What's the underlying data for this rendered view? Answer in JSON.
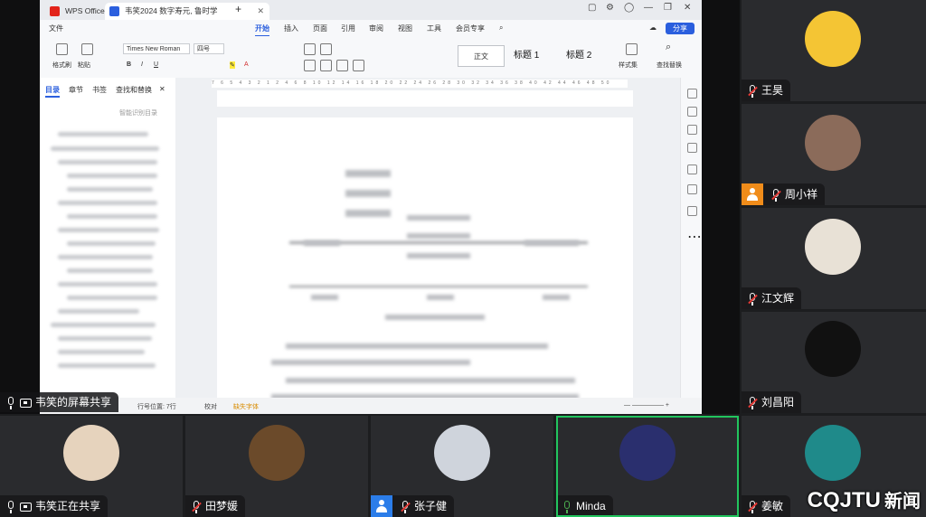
{
  "screen_share": {
    "tabs": [
      {
        "label": "WPS Office"
      },
      {
        "label": "韦笑2024 数字寿元, 鲁时学"
      }
    ],
    "menu": {
      "file": "文件",
      "tabs": [
        "开始",
        "插入",
        "页面",
        "引用",
        "审阅",
        "视图",
        "工具",
        "会员专享"
      ],
      "share": "分享"
    },
    "ribbon": {
      "format_painter": "格式刷",
      "paste": "粘贴",
      "font": "Times New Roman",
      "size": "四号",
      "style_normal": "正文",
      "heading1": "标题 1",
      "heading2": "标题 2",
      "styles_set": "样式集",
      "find_replace": "查找替换"
    },
    "left_panel": {
      "tabs": [
        "目录",
        "章节",
        "书签",
        "查找和替换"
      ],
      "toc_button": "智能识别目录"
    },
    "status_bar": {
      "position": "行号位置: 7行",
      "proofread": "校对",
      "missing_font": "缺失字体"
    },
    "sharer_caption": "韦笑的屏幕共享"
  },
  "participants_right": [
    {
      "name": "王昊",
      "avatar_color": "#f4c534"
    },
    {
      "name": "周小祥",
      "avatar_color": "#8b6b5a"
    },
    {
      "name": "江文辉",
      "avatar_color": "#e8e1d6"
    },
    {
      "name": "刘昌阳",
      "avatar_color": "#111111"
    }
  ],
  "participants_bottom": [
    {
      "name": "韦笑正在共享",
      "avatar_color": "#e6d3bd"
    },
    {
      "name": "田梦媛",
      "avatar_color": "#6b4a2a"
    },
    {
      "name": "张子健",
      "avatar_color": "#cfd4dc"
    },
    {
      "name": "Minda",
      "avatar_color": "#2a2f6e"
    },
    {
      "name": "姜敏",
      "avatar_color": "#1f8a8a"
    }
  ],
  "watermark": {
    "brand": "CQJTU",
    "suffix": "新闻"
  }
}
